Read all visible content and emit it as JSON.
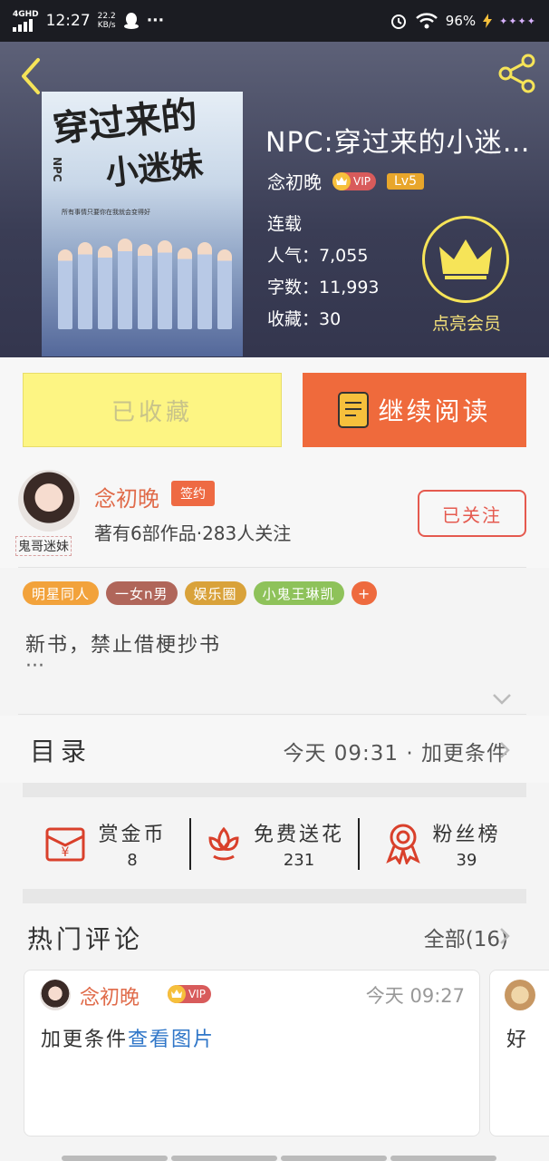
{
  "status_bar": {
    "network": "4GHD",
    "time": "12:27",
    "speed_value": "22.2",
    "speed_unit": "KB/s",
    "more": "···",
    "battery": "96%"
  },
  "book": {
    "title": "NPC:穿过来的小迷…",
    "author": "念初晚",
    "vip_label": "VIP",
    "level": "Lv5",
    "status": "连载",
    "popularity_label": "人气：",
    "popularity": "7,055",
    "words_label": "字数：",
    "words": "11,993",
    "favorites_label": "收藏：",
    "favorites": "30",
    "member_label": "点亮会员",
    "cover": {
      "title_line1": "穿过来的",
      "title_line2": "小迷妹",
      "npc": "NPC",
      "subtitle": "所有事情只要你在我就会变得好"
    }
  },
  "actions": {
    "collected_label": "已收藏",
    "read_label": "继续阅读"
  },
  "author_card": {
    "name": "念初晚",
    "contract_badge": "签约",
    "avatar_tag": "鬼哥迷妹",
    "stats": "著有6部作品·283人关注",
    "follow_label": "已关注"
  },
  "tags": [
    {
      "label": "明星同人",
      "color": "#f2a23b"
    },
    {
      "label": "一女n男",
      "color": "#b0665a"
    },
    {
      "label": "娱乐圈",
      "color": "#d9a23a"
    },
    {
      "label": "小鬼王琳凯",
      "color": "#8ec25a"
    }
  ],
  "tag_add": "+",
  "description": "新书，禁止借梗抄书",
  "description_more": "···",
  "catalog": {
    "title": "目录",
    "info": "今天 09:31 · 加更条件"
  },
  "stats": [
    {
      "label": "赏金币",
      "value": "8",
      "icon": "red-envelope-icon"
    },
    {
      "label": "免费送花",
      "value": "231",
      "icon": "flower-icon"
    },
    {
      "label": "粉丝榜",
      "value": "39",
      "icon": "medal-icon"
    }
  ],
  "comments": {
    "title": "热门评论",
    "all_label": "全部(16)",
    "items": [
      {
        "user": "念初晚",
        "vip": "VIP",
        "time": "今天 09:27",
        "text": "加更条件",
        "link": "查看图片"
      }
    ],
    "peek_text": "好"
  },
  "colors": {
    "accent_orange": "#ef6a3c",
    "collected_yellow": "#fdf583",
    "author_red": "#e06b4a",
    "link_blue": "#2f76c8"
  }
}
